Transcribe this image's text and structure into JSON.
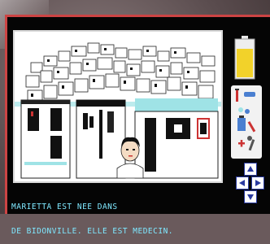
{
  "caption": {
    "line1": "MARIETTA EST NEE DANS",
    "line2": "DE BIDONVILLE. ELLE EST MEDECIN."
  },
  "icons": {
    "battery": "battery-icon",
    "inventory": "inventory-panel",
    "nav": [
      "nav-up-icon",
      "nav-left-icon",
      "nav-right-icon",
      "nav-down-icon"
    ]
  },
  "colors": {
    "caption_text": "#7fe8ff",
    "screen_bg": "#050505",
    "scene_bg": "#ffffff",
    "battery_fill": "#f2d22a",
    "accent_red": "#cc3333",
    "sky_blue": "#9fe3e6"
  }
}
